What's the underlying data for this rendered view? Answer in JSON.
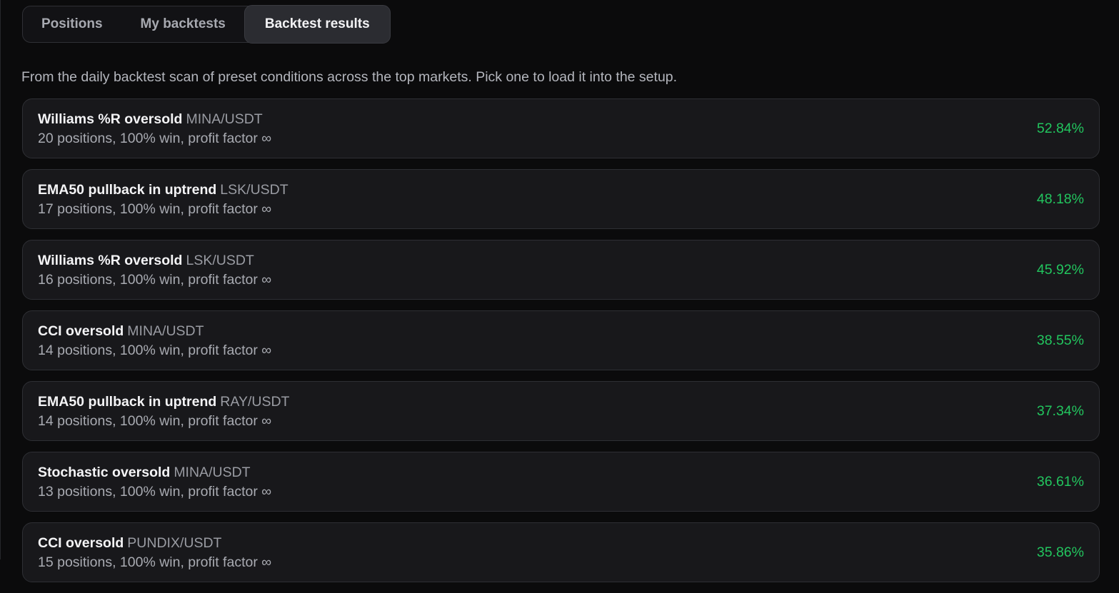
{
  "tabs": [
    {
      "label": "Positions",
      "active": false
    },
    {
      "label": "My backtests",
      "active": false
    },
    {
      "label": "Backtest results",
      "active": true
    }
  ],
  "intro": "From the daily backtest scan of preset conditions across the top markets. Pick one to load it into the setup.",
  "colors": {
    "positive": "#22c55e",
    "accent_tab": "#2b2c31"
  },
  "results": [
    {
      "name": "Williams %R oversold",
      "pair": "MINA/USDT",
      "stats": "20 positions, 100% win, profit factor ∞",
      "return": "52.84%"
    },
    {
      "name": "EMA50 pullback in uptrend",
      "pair": "LSK/USDT",
      "stats": "17 positions, 100% win, profit factor ∞",
      "return": "48.18%"
    },
    {
      "name": "Williams %R oversold",
      "pair": "LSK/USDT",
      "stats": "16 positions, 100% win, profit factor ∞",
      "return": "45.92%"
    },
    {
      "name": "CCI oversold",
      "pair": "MINA/USDT",
      "stats": "14 positions, 100% win, profit factor ∞",
      "return": "38.55%"
    },
    {
      "name": "EMA50 pullback in uptrend",
      "pair": "RAY/USDT",
      "stats": "14 positions, 100% win, profit factor ∞",
      "return": "37.34%"
    },
    {
      "name": "Stochastic oversold",
      "pair": "MINA/USDT",
      "stats": "13 positions, 100% win, profit factor ∞",
      "return": "36.61%"
    },
    {
      "name": "CCI oversold",
      "pair": "PUNDIX/USDT",
      "stats": "15 positions, 100% win, profit factor ∞",
      "return": "35.86%"
    }
  ]
}
